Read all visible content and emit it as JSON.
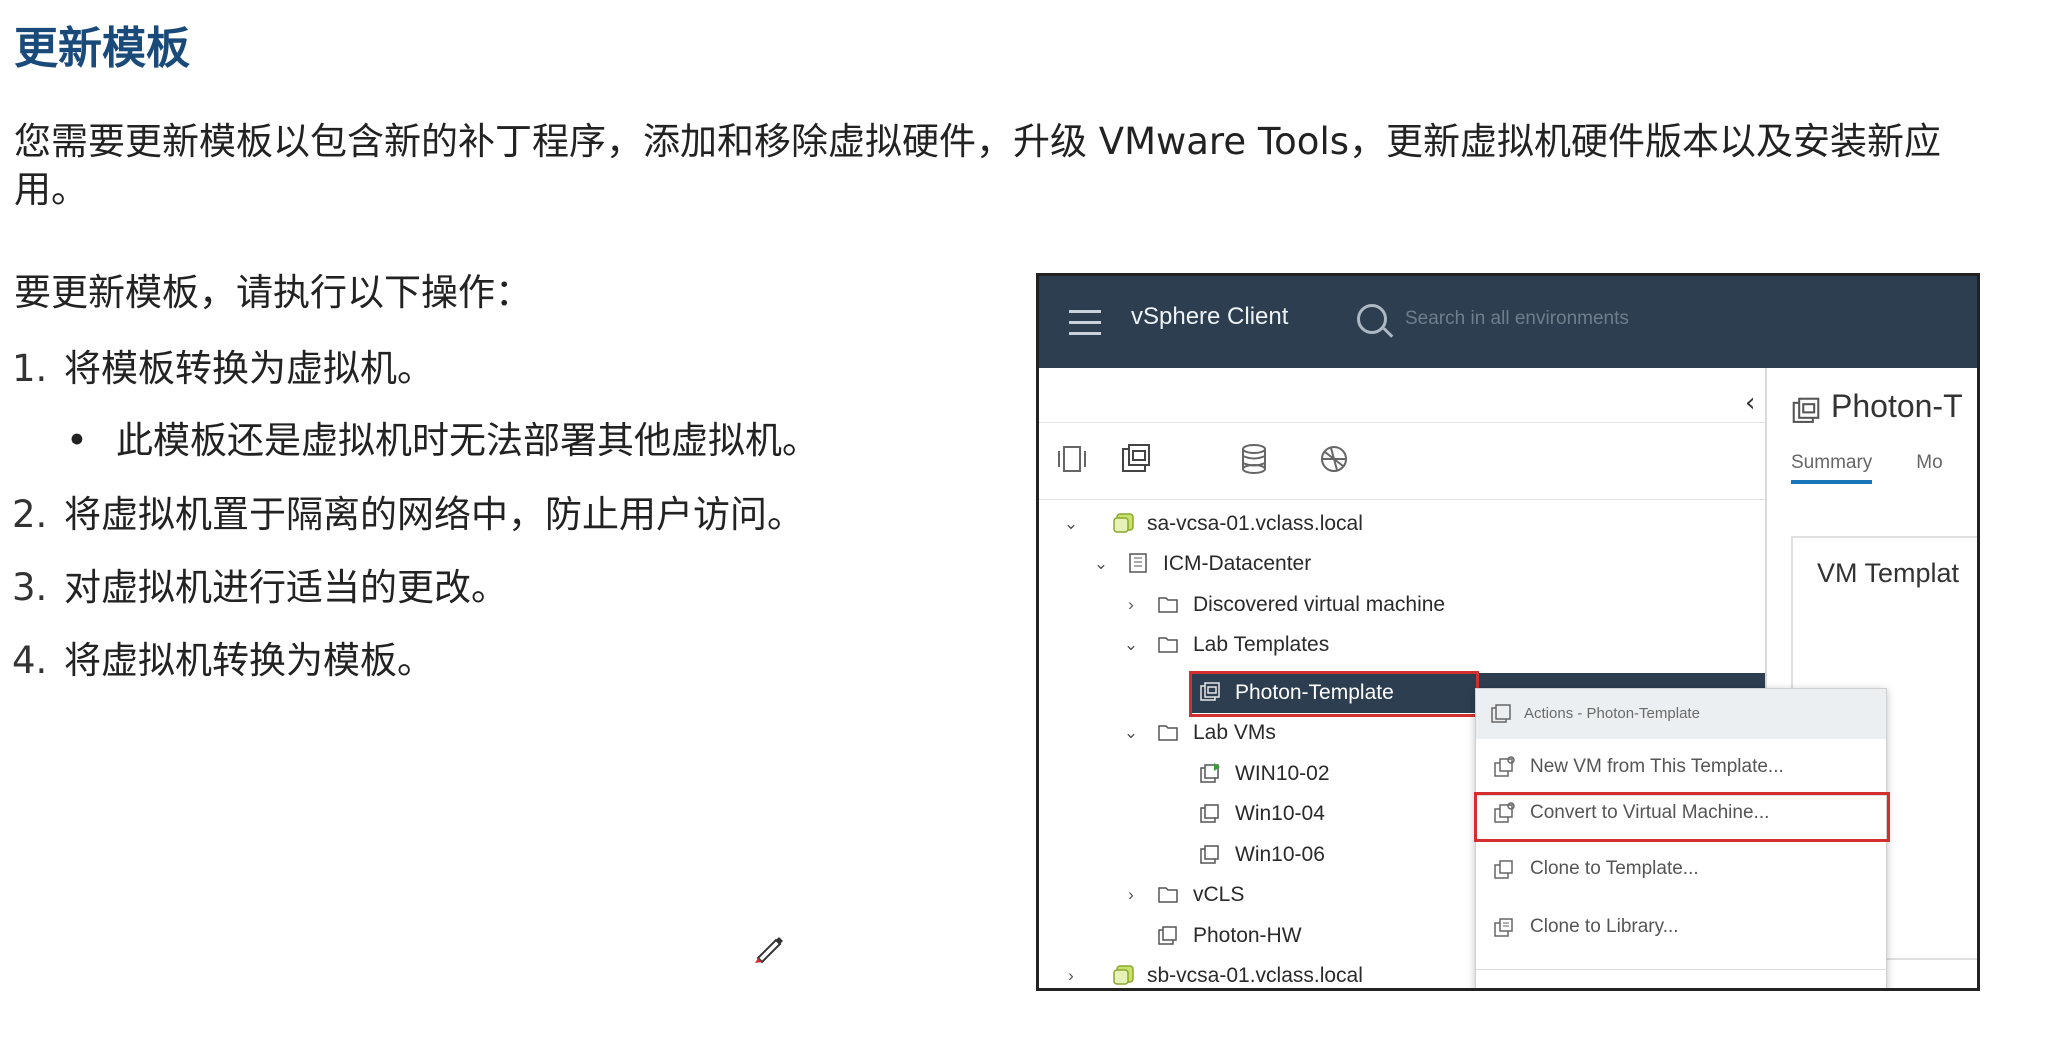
{
  "slide": {
    "title": "更新模板",
    "intro": "您需要更新模板以包含新的补丁程序，添加和移除虚拟硬件，升级 VMware Tools，更新虚拟机硬件版本以及安装新应用。",
    "lead": "要更新模板，请执行以下操作：",
    "steps": [
      {
        "num": "1.",
        "text": "将模板转换为虚拟机。"
      },
      {
        "num": "2.",
        "text": "将虚拟机置于隔离的网络中，防止用户访问。"
      },
      {
        "num": "3.",
        "text": "对虚拟机进行适当的更改。"
      },
      {
        "num": "4.",
        "text": "将虚拟机转换为模板。"
      }
    ],
    "bullet": "此模板还是虚拟机时无法部署其他虚拟机。"
  },
  "vsphere": {
    "brand": "vSphere Client",
    "search_placeholder": "Search in all environments",
    "tree": [
      {
        "label": "sa-vcsa-01.vclass.local",
        "chev": "⌄",
        "icon": "vcenter-icon"
      },
      {
        "label": "ICM-Datacenter",
        "chev": "⌄",
        "icon": "datacenter-icon"
      },
      {
        "label": "Discovered virtual machine",
        "chev": "›",
        "icon": "folder-icon"
      },
      {
        "label": "Lab Templates",
        "chev": "⌄",
        "icon": "folder-icon"
      },
      {
        "label": "Photon-Template",
        "chev": "",
        "icon": "template-icon"
      },
      {
        "label": "Lab VMs",
        "chev": "⌄",
        "icon": "folder-icon"
      },
      {
        "label": "WIN10-02",
        "chev": "",
        "icon": "vm-icon"
      },
      {
        "label": "Win10-04",
        "chev": "",
        "icon": "vm-icon"
      },
      {
        "label": "Win10-06",
        "chev": "",
        "icon": "vm-icon"
      },
      {
        "label": "vCLS",
        "chev": "›",
        "icon": "folder-icon"
      },
      {
        "label": "Photon-HW",
        "chev": "",
        "icon": "vm-icon"
      },
      {
        "label": "sb-vcsa-01.vclass.local",
        "chev": "›",
        "icon": "vcenter-icon"
      }
    ],
    "right_title": "Photon-T",
    "right_tabs": [
      "Summary",
      "Mo"
    ],
    "card_title": "VM Templat",
    "context_menu": {
      "header": "Actions - Photon-Template",
      "items": [
        "New VM from This Template...",
        "Convert to Virtual Machine...",
        "Clone to Template...",
        "Clone to Library..."
      ]
    }
  },
  "colors": {
    "title": "#1a4a7a",
    "topbar": "#2c3e50",
    "highlight": "#d32f2f",
    "accent": "#1a74b8"
  }
}
